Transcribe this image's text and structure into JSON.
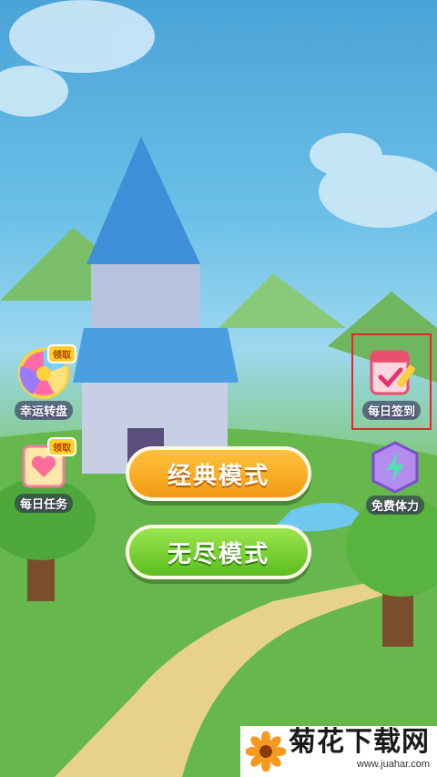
{
  "left_menu": {
    "wheel": {
      "label": "幸运转盘",
      "badge": "领取"
    },
    "tasks": {
      "label": "每日任务",
      "badge": "领取"
    }
  },
  "right_menu": {
    "checkin": {
      "label": "每日签到"
    },
    "energy": {
      "label": "免费体力"
    }
  },
  "modes": {
    "classic": "经典模式",
    "endless": "无尽模式"
  },
  "watermark": {
    "title": "菊花下载网",
    "url": "www.juahar.com"
  },
  "colors": {
    "classic_button": "#f29a14",
    "endless_button": "#5cbe1e",
    "highlight_box": "#e0282c"
  }
}
